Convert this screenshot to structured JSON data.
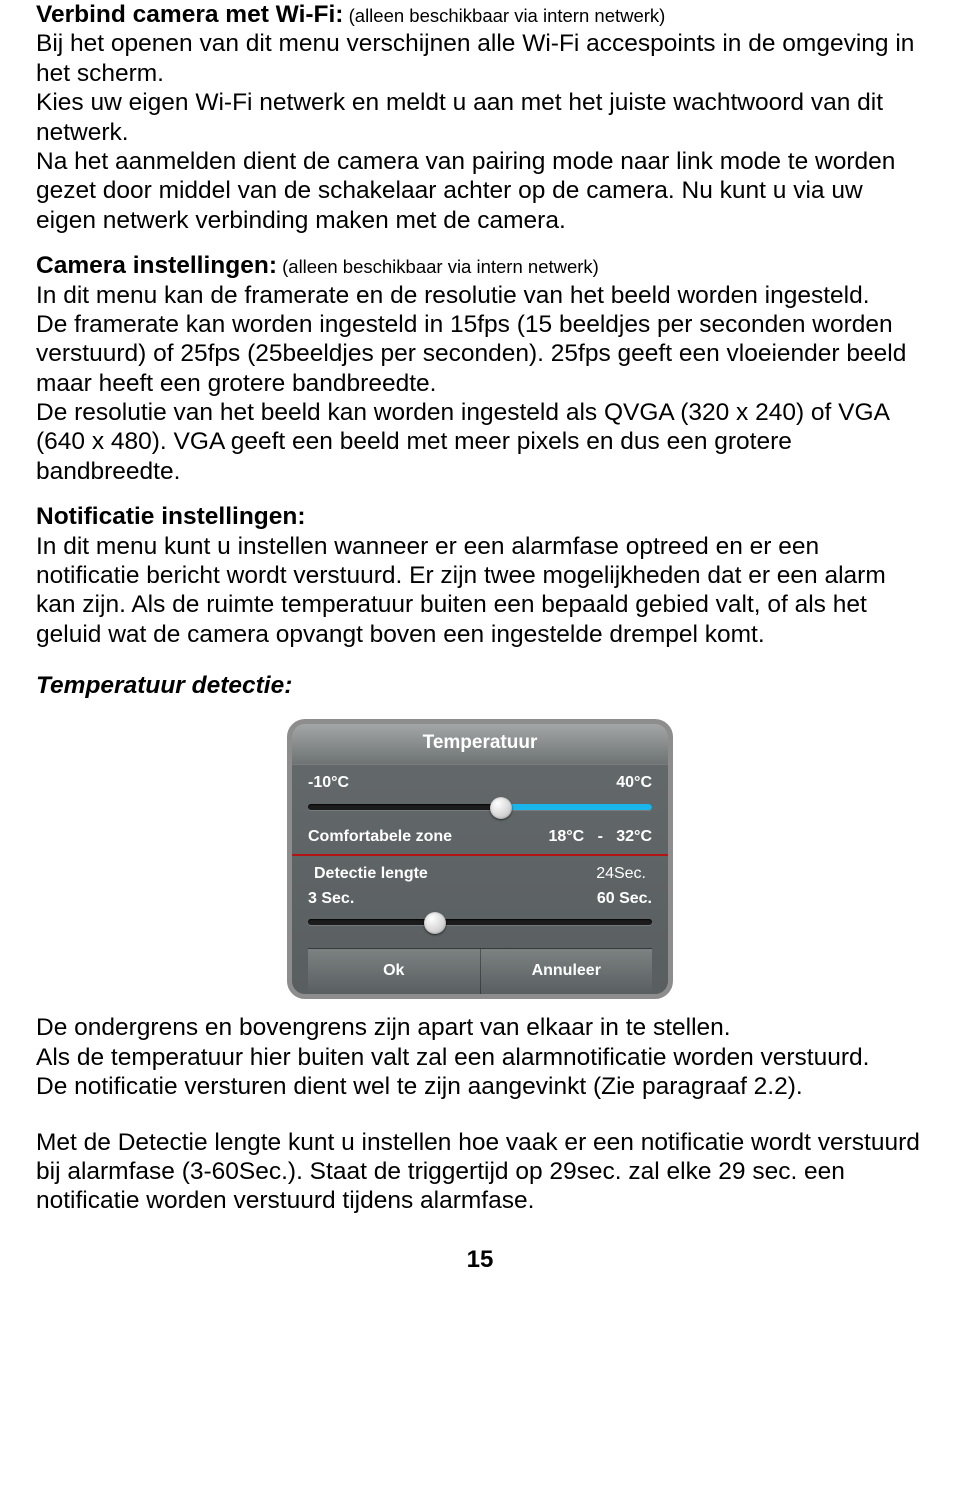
{
  "section1": {
    "title": "Verbind camera met Wi-Fi:",
    "title_small": " (alleen beschikbaar via intern netwerk)",
    "p1": "Bij het openen van dit menu verschijnen alle Wi-Fi accespoints in de omgeving in het scherm.",
    "p2": "Kies uw eigen Wi-Fi netwerk en meldt u aan met het juiste wachtwoord van dit netwerk.",
    "p3": "Na het aanmelden dient de camera van pairing mode naar link mode te worden gezet door middel van de schakelaar achter op de camera. Nu kunt u via uw eigen netwerk verbinding maken met de camera."
  },
  "section2": {
    "title": "Camera instellingen:",
    "title_small": " (alleen beschikbaar via intern netwerk)",
    "p1": "In dit menu kan de framerate en de resolutie van het beeld worden ingesteld.",
    "p2": "De framerate kan worden ingesteld in 15fps (15 beeldjes per seconden worden verstuurd) of 25fps (25beeldjes per seconden). 25fps geeft een vloeiender beeld maar heeft een grotere bandbreedte.",
    "p3": "De resolutie van het beeld kan worden ingesteld als QVGA (320 x 240) of VGA (640 x 480). VGA geeft een beeld met meer pixels en dus een grotere bandbreedte."
  },
  "section3": {
    "title": "Notificatie instellingen:",
    "p1": "In dit menu kunt u instellen wanneer er een alarmfase optreed en er een notificatie bericht wordt verstuurd. Er zijn twee mogelijkheden dat er een alarm kan zijn. Als de ruimte temperatuur buiten een bepaald gebied valt, of als het geluid wat de camera opvangt boven een ingestelde drempel komt."
  },
  "section4": {
    "title": "Temperatuur detectie:"
  },
  "widget": {
    "header": "Temperatuur",
    "range_min": "-10°C",
    "range_max": "40°C",
    "comfort_label": "Comfortabele zone",
    "comfort_low": "18°C",
    "comfort_sep": "-",
    "comfort_high": "32°C",
    "detect_label": "Detectie lengte",
    "detect_value": "24Sec.",
    "detect_min": "3 Sec.",
    "detect_max": "60 Sec.",
    "ok": "Ok",
    "cancel": "Annuleer"
  },
  "footer": {
    "p1": "De ondergrens en bovengrens zijn apart van elkaar in te stellen.",
    "p2": "Als de temperatuur hier buiten valt zal een alarmnotificatie worden verstuurd.",
    "p3": "De notificatie versturen dient wel te zijn aangevinkt (Zie paragraaf 2.2).",
    "p4": "Met de Detectie lengte kunt u instellen hoe vaak er een notificatie wordt verstuurd bij alarmfase (3-60Sec.). Staat de triggertijd op 29sec. zal elke 29 sec. een notificatie worden verstuurd tijdens alarmfase."
  },
  "page_number": "15"
}
